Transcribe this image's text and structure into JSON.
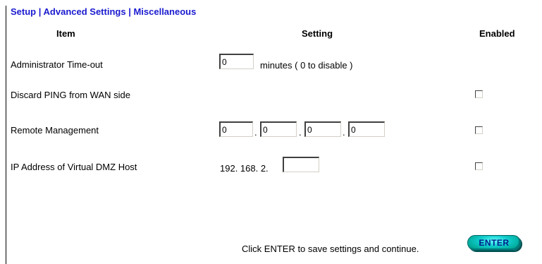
{
  "breadcrumb": {
    "setup": "Setup",
    "sep1": "|",
    "advanced": "Advanced Settings",
    "sep2": "|",
    "misc": "Miscellaneous"
  },
  "table_headers": {
    "item": "Item",
    "setting": "Setting",
    "enabled": "Enabled"
  },
  "rows": {
    "admin_timeout": {
      "label": "Administrator Time-out",
      "value": "0",
      "suffix": "minutes ( 0 to disable )"
    },
    "discard_ping": {
      "label": "Discard PING from WAN side",
      "enabled": false
    },
    "remote_mgmt": {
      "label": "Remote Management",
      "octets": [
        "0",
        "0",
        "0",
        "0"
      ],
      "enabled": false
    },
    "dmz_host": {
      "label": "IP Address of Virtual DMZ Host",
      "prefix": "192. 168. 2.",
      "value": "",
      "enabled": false
    }
  },
  "footer": {
    "message": "Click ENTER to save settings and continue.",
    "enter_label": "ENTER"
  },
  "colors": {
    "breadcrumb": "#1a1ad0",
    "enter_button": "#11cccc"
  }
}
